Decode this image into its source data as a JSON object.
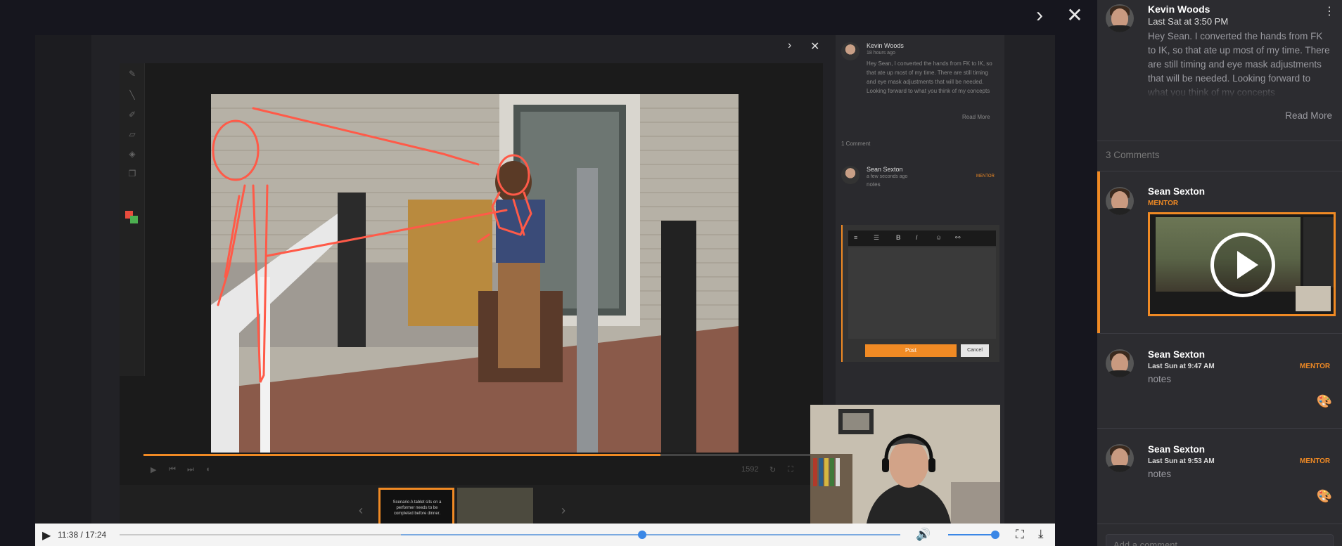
{
  "overlay": {
    "next_icon": "chevron-right-icon",
    "close_icon": "close-icon"
  },
  "recording": {
    "panel": {
      "author": "Kevin Woods",
      "time": "18 hours ago",
      "body": "Hey Sean, I converted the hands from FK to IK, so that ate up most of my time. There are still timing and eye mask adjustments that will be needed. Looking forward to what you think of my concepts",
      "read_more": "Read More",
      "comment_count": "1 Comment",
      "reply_author": "Sean Sexton",
      "reply_time": "a few seconds ago",
      "reply_text": "notes",
      "reply_badge": "MENTOR",
      "post_label": "Post",
      "cancel_label": "Cancel"
    },
    "frame_counter": "1592",
    "thumb1_text": "Scenario A tablet sits on a performer needs to be completed before dinner."
  },
  "player": {
    "time": "11:38 / 17:24",
    "progress": 0.669,
    "buffered_start": 0.36,
    "buffered_end": 1.0,
    "volume": 0.85
  },
  "post": {
    "author": "Kevin Woods",
    "time": "Last Sat at 3:50 PM",
    "body": "Hey Sean. I converted the hands from FK to IK, so that ate up most of my time. There are still timing and eye mask adjustments that will be needed. Looking forward to what you think of my concepts",
    "read_more": "Read More"
  },
  "comments_header": "3 Comments",
  "comments": [
    {
      "author": "Sean Sexton",
      "badge": "MENTOR",
      "time": "",
      "text": ""
    },
    {
      "author": "Sean Sexton",
      "badge": "MENTOR",
      "time": "Last Sun at 9:47 AM",
      "text": "notes"
    },
    {
      "author": "Sean Sexton",
      "badge": "MENTOR",
      "time": "Last Sun at 9:53 AM",
      "text": "notes"
    }
  ],
  "add_comment_placeholder": "Add a comment...",
  "colors": {
    "accent": "#f08a24",
    "slider": "#3a87e6",
    "panel": "#2c2c30"
  }
}
